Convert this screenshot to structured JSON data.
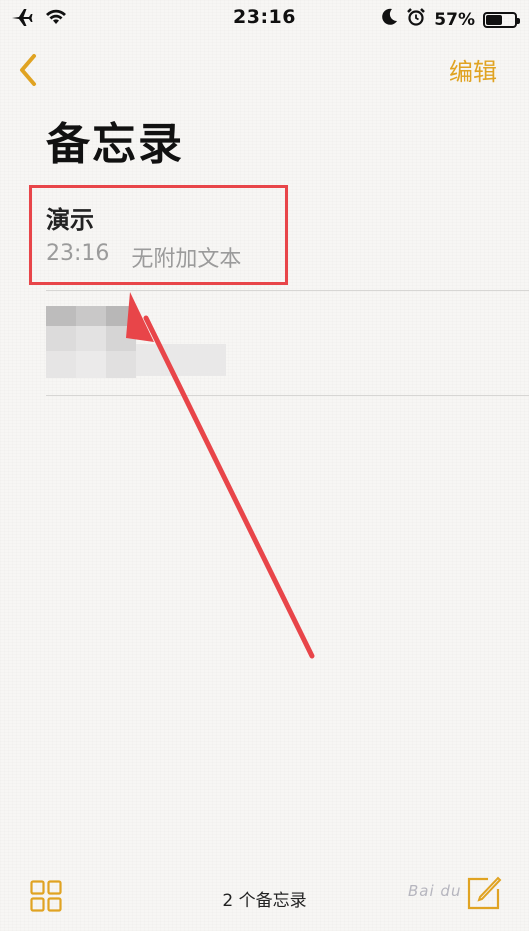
{
  "status_bar": {
    "time": "23:16",
    "battery_text": "57%",
    "battery_level": 0.57,
    "icons": [
      "airplane-icon",
      "wifi-icon",
      "moon-icon",
      "alarm-icon",
      "battery-icon"
    ]
  },
  "nav": {
    "back_icon": "chevron-left-icon",
    "edit_label": "编辑",
    "accent_color": "#e0a322"
  },
  "page": {
    "title": "备忘录"
  },
  "notes": [
    {
      "title": "演示",
      "time": "23:16",
      "preview": "无附加文本"
    }
  ],
  "footer": {
    "count_label": "2 个备忘录",
    "grid_icon": "grid-view-icon",
    "compose_icon": "compose-icon"
  },
  "annotation": {
    "highlight_color": "#e84549",
    "arrow_color": "#e84549"
  },
  "watermark": "Bai du"
}
